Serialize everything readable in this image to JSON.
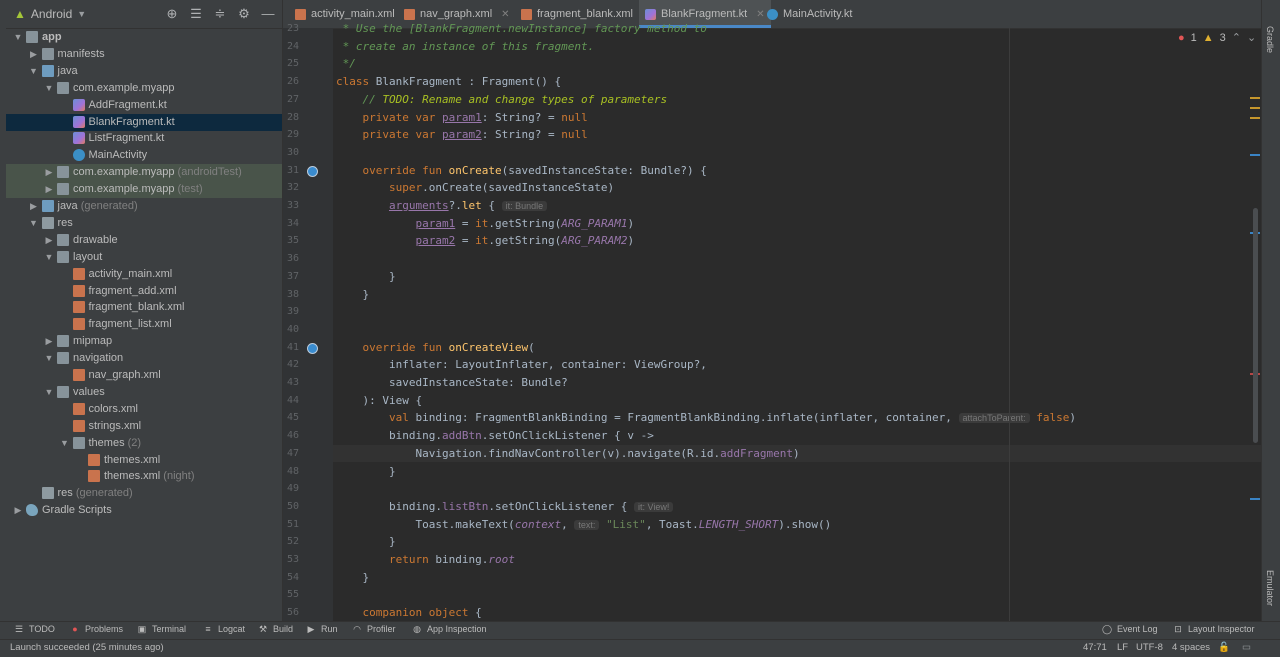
{
  "project": {
    "view_label": "Android",
    "tree": [
      {
        "label": "app",
        "indent": 0,
        "arrow": "open",
        "icon": "folder",
        "bold": true
      },
      {
        "label": "manifests",
        "indent": 1,
        "arrow": "closed",
        "icon": "folder"
      },
      {
        "label": "java",
        "indent": 1,
        "arrow": "open",
        "icon": "folder-blue"
      },
      {
        "label": "com.example.myapp",
        "indent": 2,
        "arrow": "open",
        "icon": "folder"
      },
      {
        "label": "AddFragment.kt",
        "indent": 3,
        "icon": "kt"
      },
      {
        "label": "BlankFragment.kt",
        "indent": 3,
        "icon": "kt",
        "selected": true
      },
      {
        "label": "ListFragment.kt",
        "indent": 3,
        "icon": "kt"
      },
      {
        "label": "MainActivity",
        "indent": 3,
        "icon": "class"
      },
      {
        "label": "com.example.myapp",
        "suffix": "(androidTest)",
        "indent": 2,
        "arrow": "closed",
        "icon": "folder",
        "test": true
      },
      {
        "label": "com.example.myapp",
        "suffix": "(test)",
        "indent": 2,
        "arrow": "closed",
        "icon": "folder",
        "test": true
      },
      {
        "label": "java",
        "suffix": "(generated)",
        "indent": 1,
        "arrow": "closed",
        "icon": "folder-blue"
      },
      {
        "label": "res",
        "indent": 1,
        "arrow": "open",
        "icon": "res"
      },
      {
        "label": "drawable",
        "indent": 2,
        "arrow": "closed",
        "icon": "folder"
      },
      {
        "label": "layout",
        "indent": 2,
        "arrow": "open",
        "icon": "folder"
      },
      {
        "label": "activity_main.xml",
        "indent": 3,
        "icon": "xml"
      },
      {
        "label": "fragment_add.xml",
        "indent": 3,
        "icon": "xml"
      },
      {
        "label": "fragment_blank.xml",
        "indent": 3,
        "icon": "xml"
      },
      {
        "label": "fragment_list.xml",
        "indent": 3,
        "icon": "xml"
      },
      {
        "label": "mipmap",
        "indent": 2,
        "arrow": "closed",
        "icon": "folder"
      },
      {
        "label": "navigation",
        "indent": 2,
        "arrow": "open",
        "icon": "folder"
      },
      {
        "label": "nav_graph.xml",
        "indent": 3,
        "icon": "xml"
      },
      {
        "label": "values",
        "indent": 2,
        "arrow": "open",
        "icon": "folder"
      },
      {
        "label": "colors.xml",
        "indent": 3,
        "icon": "xml"
      },
      {
        "label": "strings.xml",
        "indent": 3,
        "icon": "xml"
      },
      {
        "label": "themes",
        "suffix": "(2)",
        "indent": 3,
        "arrow": "open",
        "icon": "folder"
      },
      {
        "label": "themes.xml",
        "indent": 4,
        "icon": "xml"
      },
      {
        "label": "themes.xml",
        "suffix": "(night)",
        "indent": 4,
        "icon": "xml"
      },
      {
        "label": "res",
        "suffix": "(generated)",
        "indent": 1,
        "icon": "res"
      },
      {
        "label": "Gradle Scripts",
        "indent": 0,
        "arrow": "closed",
        "icon": "gradle"
      }
    ]
  },
  "tabs": [
    {
      "label": "activity_main.xml",
      "icon": "xml"
    },
    {
      "label": "nav_graph.xml",
      "icon": "xml"
    },
    {
      "label": "fragment_blank.xml",
      "icon": "xml"
    },
    {
      "label": "BlankFragment.kt",
      "icon": "kt",
      "active": true
    },
    {
      "label": "MainActivity.kt",
      "icon": "class"
    }
  ],
  "inspection": {
    "errors": "1",
    "warnings": "3"
  },
  "code": {
    "line_numbers": [
      "23",
      "24",
      "25",
      "26",
      "27",
      "28",
      "29",
      "30",
      "31",
      "32",
      "33",
      "34",
      "35",
      "36",
      "37",
      "38",
      "39",
      "40",
      "41",
      "42",
      "43",
      "44",
      "45",
      "46",
      "47",
      "48",
      "49",
      "50",
      "51",
      "52",
      "53",
      "54",
      "55",
      "56"
    ],
    "lines": [
      [
        {
          "t": " * Use the [BlankFragment.newInstance] factory method to",
          "c": "cm"
        }
      ],
      [
        {
          "t": " * create an instance of this fragment.",
          "c": "cm"
        }
      ],
      [
        {
          "t": " */",
          "c": "cm"
        }
      ],
      [
        {
          "t": "class",
          "c": "kw"
        },
        {
          "t": " BlankFragment : Fragment() {"
        }
      ],
      [
        {
          "t": "    "
        },
        {
          "t": "// ",
          "c": "cm"
        },
        {
          "t": "TODO: Rename and change types of parameters",
          "c": "td"
        }
      ],
      [
        {
          "t": "    "
        },
        {
          "t": "private var",
          "c": "kw"
        },
        {
          "t": " "
        },
        {
          "t": "param1",
          "c": "pv ul"
        },
        {
          "t": ": String? = "
        },
        {
          "t": "null",
          "c": "kw"
        }
      ],
      [
        {
          "t": "    "
        },
        {
          "t": "private var",
          "c": "kw"
        },
        {
          "t": " "
        },
        {
          "t": "param2",
          "c": "pv ul"
        },
        {
          "t": ": String? = "
        },
        {
          "t": "null",
          "c": "kw"
        }
      ],
      [],
      [
        {
          "t": "    "
        },
        {
          "t": "override fun",
          "c": "kw"
        },
        {
          "t": " "
        },
        {
          "t": "onCreate",
          "c": "fn"
        },
        {
          "t": "(savedInstanceState: Bundle?) {"
        }
      ],
      [
        {
          "t": "        "
        },
        {
          "t": "super",
          "c": "kw"
        },
        {
          "t": ".onCreate(savedInstanceState)"
        }
      ],
      [
        {
          "t": "        "
        },
        {
          "t": "arguments",
          "c": "pv ul"
        },
        {
          "t": "?."
        },
        {
          "t": "let",
          "c": "fn"
        },
        {
          "t": " { "
        },
        {
          "t": "it: Bundle",
          "c": "hint"
        }
      ],
      [
        {
          "t": "            "
        },
        {
          "t": "param1",
          "c": "pv ul"
        },
        {
          "t": " = "
        },
        {
          "t": "it",
          "c": "kw"
        },
        {
          "t": ".getString("
        },
        {
          "t": "ARG_PARAM1",
          "c": "pvi"
        },
        {
          "t": ")"
        }
      ],
      [
        {
          "t": "            "
        },
        {
          "t": "param2",
          "c": "pv ul"
        },
        {
          "t": " = "
        },
        {
          "t": "it",
          "c": "kw"
        },
        {
          "t": ".getString("
        },
        {
          "t": "ARG_PARAM2",
          "c": "pvi"
        },
        {
          "t": ")"
        }
      ],
      [],
      [
        {
          "t": "        }"
        }
      ],
      [
        {
          "t": "    }"
        }
      ],
      [],
      [],
      [
        {
          "t": "    "
        },
        {
          "t": "override fun",
          "c": "kw"
        },
        {
          "t": " "
        },
        {
          "t": "onCreateView",
          "c": "fn"
        },
        {
          "t": "("
        }
      ],
      [
        {
          "t": "        inflater: LayoutInflater, container: ViewGroup?,"
        }
      ],
      [
        {
          "t": "        savedInstanceState: Bundle?"
        }
      ],
      [
        {
          "t": "    ): View {"
        }
      ],
      [
        {
          "t": "        "
        },
        {
          "t": "val",
          "c": "kw"
        },
        {
          "t": " binding: FragmentBlankBinding = FragmentBlankBinding.inflate(inflater, container, "
        },
        {
          "t": "attachToParent:",
          "c": "hint"
        },
        {
          "t": " "
        },
        {
          "t": "false",
          "c": "kw"
        },
        {
          "t": ")"
        }
      ],
      [
        {
          "t": "        binding."
        },
        {
          "t": "addBtn",
          "c": "pv"
        },
        {
          "t": ".setOnClickListener { v ->"
        }
      ],
      [
        {
          "t": "            Navigation.findNavController(v).navigate(R.id."
        },
        {
          "t": "addFragment",
          "c": "pv"
        },
        {
          "t": ")"
        }
      ],
      [
        {
          "t": "        }"
        }
      ],
      [],
      [
        {
          "t": "        binding."
        },
        {
          "t": "listBtn",
          "c": "pv"
        },
        {
          "t": ".setOnClickListener { "
        },
        {
          "t": "it: View!",
          "c": "hint"
        }
      ],
      [
        {
          "t": "            Toast.makeText("
        },
        {
          "t": "context",
          "c": "pvi"
        },
        {
          "t": ", "
        },
        {
          "t": "text:",
          "c": "hint"
        },
        {
          "t": " "
        },
        {
          "t": "\"List\"",
          "c": "str"
        },
        {
          "t": ", Toast."
        },
        {
          "t": "LENGTH_SHORT",
          "c": "pvi"
        },
        {
          "t": ").show()"
        }
      ],
      [
        {
          "t": "        }"
        }
      ],
      [
        {
          "t": "        "
        },
        {
          "t": "return",
          "c": "kw"
        },
        {
          "t": " binding."
        },
        {
          "t": "root",
          "c": "pvi"
        }
      ],
      [
        {
          "t": "    }"
        }
      ],
      [],
      [
        {
          "t": "    "
        },
        {
          "t": "companion object",
          "c": "kw"
        },
        {
          "t": " {"
        }
      ]
    ]
  },
  "right_tools": {
    "gradle": "Gradle",
    "emulator": "Emulator"
  },
  "bottom_tools": [
    {
      "label": "TODO",
      "icon": "list-icon"
    },
    {
      "label": "Problems",
      "icon": "problems-icon"
    },
    {
      "label": "Terminal",
      "icon": "terminal-icon"
    },
    {
      "label": "Logcat",
      "icon": "logcat-icon"
    },
    {
      "label": "Build",
      "icon": "build-icon"
    },
    {
      "label": "Run",
      "icon": "run-icon"
    },
    {
      "label": "Profiler",
      "icon": "profiler-icon"
    },
    {
      "label": "App Inspection",
      "icon": "inspection-icon"
    }
  ],
  "bottom_tools_right": [
    {
      "label": "Event Log",
      "icon": "event-log-icon"
    },
    {
      "label": "Layout Inspector",
      "icon": "layout-inspector-icon"
    }
  ],
  "status": {
    "message": "Launch succeeded (25 minutes ago)",
    "position": "47:71",
    "line_sep": "LF",
    "encoding": "UTF-8",
    "indent": "4 spaces"
  },
  "colors": {
    "accent": "#4a88c7",
    "background": "#2b2b2b",
    "panel": "#3c3f41"
  }
}
